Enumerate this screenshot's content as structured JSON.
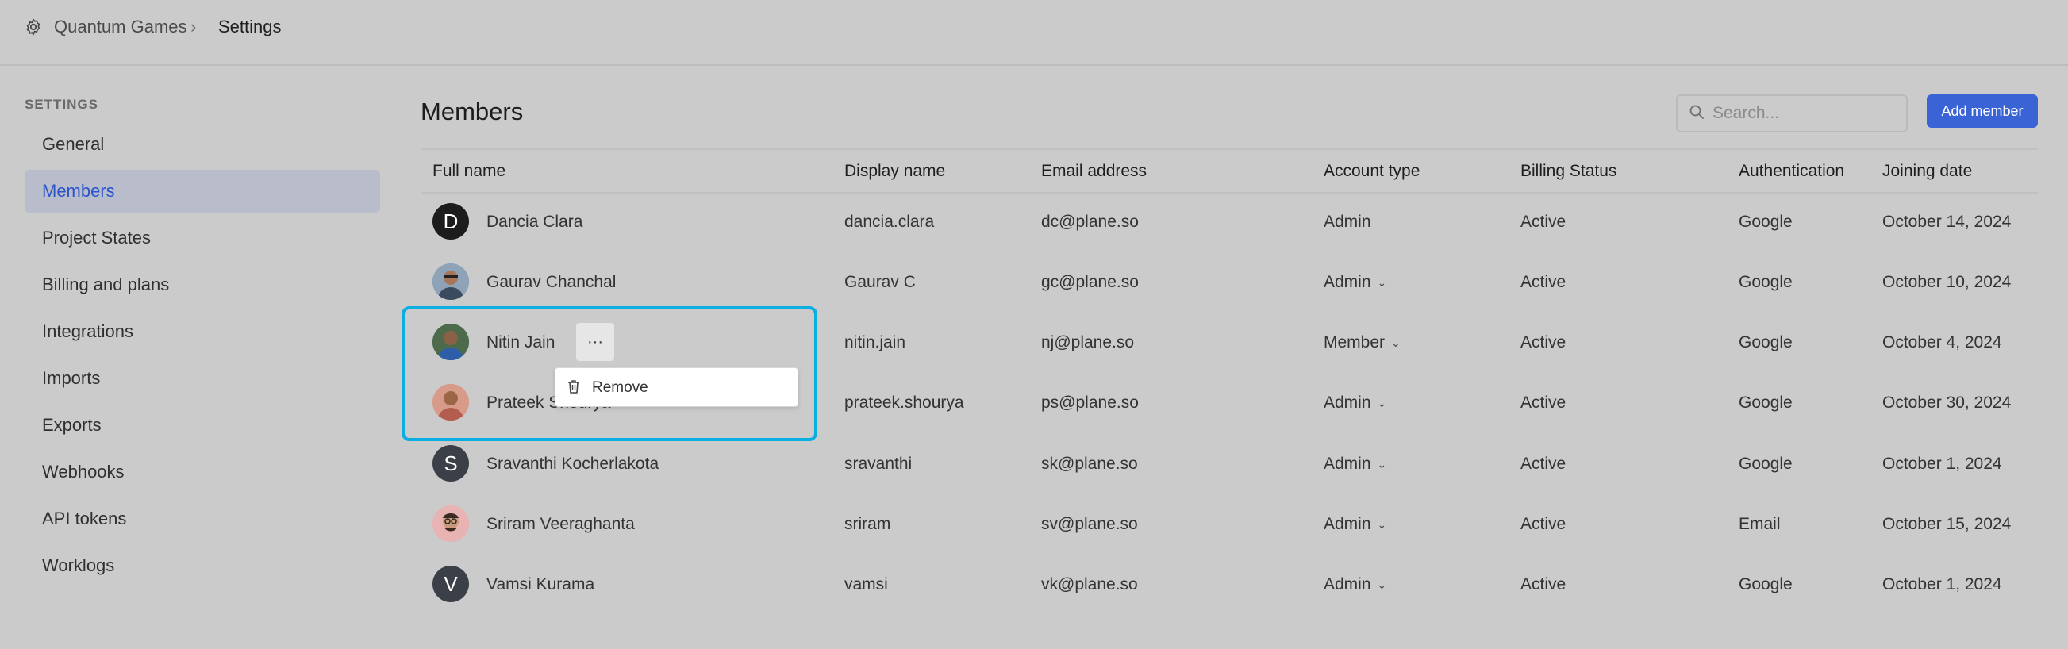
{
  "breadcrumb": {
    "workspace": "Quantum Games",
    "page": "Settings"
  },
  "sidebar": {
    "heading": "SETTINGS",
    "items": [
      {
        "label": "General",
        "active": false
      },
      {
        "label": "Members",
        "active": true
      },
      {
        "label": "Project States",
        "active": false
      },
      {
        "label": "Billing and plans",
        "active": false
      },
      {
        "label": "Integrations",
        "active": false
      },
      {
        "label": "Imports",
        "active": false
      },
      {
        "label": "Exports",
        "active": false
      },
      {
        "label": "Webhooks",
        "active": false
      },
      {
        "label": "API tokens",
        "active": false
      },
      {
        "label": "Worklogs",
        "active": false
      }
    ]
  },
  "main": {
    "title": "Members",
    "search": {
      "placeholder": "Search..."
    },
    "add_member_label": "Add member"
  },
  "table": {
    "columns": [
      "Full name",
      "Display name",
      "Email address",
      "Account type",
      "Billing Status",
      "Authentication",
      "Joining date"
    ],
    "rows": [
      {
        "avatar": "D",
        "full_name": "Dancia Clara",
        "display_name": "dancia.clara",
        "email": "dc@plane.so",
        "account_type": "Admin",
        "has_dropdown": false,
        "billing": "Active",
        "auth": "Google",
        "joined": "October 14, 2024"
      },
      {
        "avatar": "photo",
        "full_name": "Gaurav Chanchal",
        "display_name": "Gaurav C",
        "email": "gc@plane.so",
        "account_type": "Admin",
        "has_dropdown": true,
        "billing": "Active",
        "auth": "Google",
        "joined": "October 10, 2024"
      },
      {
        "avatar": "photo",
        "full_name": "Nitin Jain",
        "display_name": "nitin.jain",
        "email": "nj@plane.so",
        "account_type": "Member",
        "has_dropdown": true,
        "billing": "Active",
        "auth": "Google",
        "joined": "October 4, 2024"
      },
      {
        "avatar": "photo",
        "full_name": "Prateek Shourya",
        "display_name": "prateek.shourya",
        "email": "ps@plane.so",
        "account_type": "Admin",
        "has_dropdown": true,
        "billing": "Active",
        "auth": "Google",
        "joined": "October 30, 2024"
      },
      {
        "avatar": "S",
        "full_name": "Sravanthi Kocherlakota",
        "display_name": "sravanthi",
        "email": "sk@plane.so",
        "account_type": "Admin",
        "has_dropdown": true,
        "billing": "Active",
        "auth": "Google",
        "joined": "October 1, 2024"
      },
      {
        "avatar": "photo",
        "full_name": "Sriram Veeraghanta",
        "display_name": "sriram",
        "email": "sv@plane.so",
        "account_type": "Admin",
        "has_dropdown": true,
        "billing": "Active",
        "auth": "Email",
        "joined": "October 15, 2024"
      },
      {
        "avatar": "V",
        "full_name": "Vamsi Kurama",
        "display_name": "vamsi",
        "email": "vk@plane.so",
        "account_type": "Admin",
        "has_dropdown": true,
        "billing": "Active",
        "auth": "Google",
        "joined": "October 1, 2024"
      }
    ]
  },
  "row_menu": {
    "more_label": "···",
    "items": [
      {
        "label": "Remove",
        "icon": "trash-icon"
      }
    ]
  },
  "colors": {
    "accent": "#3a64d6",
    "highlight": "#0aaee0",
    "active_nav_text": "#2b54c9"
  }
}
